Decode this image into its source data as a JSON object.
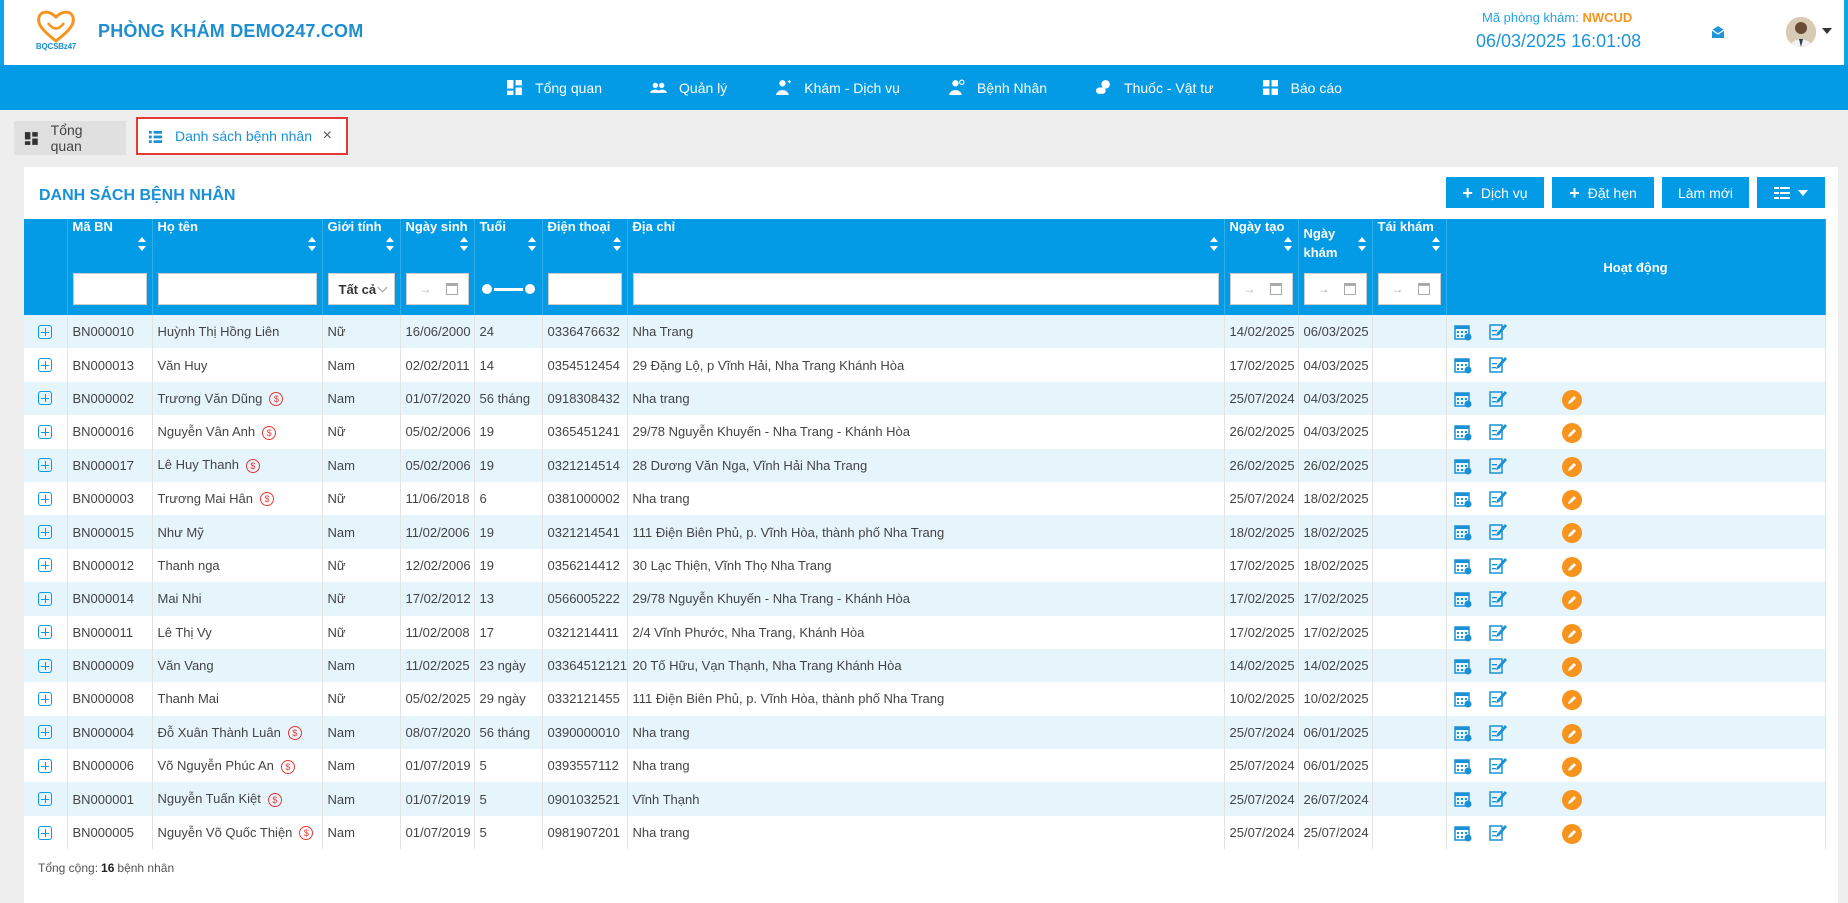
{
  "header": {
    "logo_text": "BQCSBz47",
    "clinic_name": "PHÒNG KHÁM DEMO247.COM",
    "clinic_code_label": "Mã phòng khám:",
    "clinic_code": "NWCUD",
    "datetime": "06/03/2025 16:01:08"
  },
  "nav": [
    {
      "label": "Tổng quan",
      "icon": "dashboard-icon"
    },
    {
      "label": "Quản lý",
      "icon": "users-icon"
    },
    {
      "label": "Khám - Dịch vụ",
      "icon": "doctor-icon"
    },
    {
      "label": "Bệnh Nhân",
      "icon": "patient-icon"
    },
    {
      "label": "Thuốc - Vật tư",
      "icon": "medicine-icon"
    },
    {
      "label": "Báo cáo",
      "icon": "report-icon"
    }
  ],
  "tabs": {
    "overview": "Tổng quan",
    "patients": "Danh sách bệnh nhân",
    "close": "×"
  },
  "panel": {
    "title": "DANH SÁCH BỆNH NHÂN",
    "btn_service": "Dịch vụ",
    "btn_appointment": "Đặt hẹn",
    "btn_refresh": "Làm mới",
    "btn_plus": "+"
  },
  "columns": {
    "code": "Mã BN",
    "name": "Họ tên",
    "gender": "Giới tính",
    "dob": "Ngày sinh",
    "age": "Tuổi",
    "phone": "Điện thoại",
    "address": "Địa chỉ",
    "created": "Ngày tạo",
    "visit": "Ngày khám",
    "revisit": "Tái khám",
    "actions": "Hoạt động"
  },
  "filters": {
    "gender_value": "Tất cả",
    "date_arrow": "→"
  },
  "money_symbol": "$",
  "rows": [
    {
      "code": "BN000010",
      "name": "Huỳnh Thị Hồng Liên",
      "money": false,
      "gender": "Nữ",
      "dob": "16/06/2000",
      "age": "24",
      "phone": "0336476632",
      "address": "Nha Trang",
      "created": "14/02/2025",
      "visit": "06/03/2025",
      "edit": false
    },
    {
      "code": "BN000013",
      "name": "Văn Huy",
      "money": false,
      "gender": "Nam",
      "dob": "02/02/2011",
      "age": "14",
      "phone": "0354512454",
      "address": "29 Đặng Lộ, p Vĩnh Hải, Nha Trang Khánh Hòa",
      "created": "17/02/2025",
      "visit": "04/03/2025",
      "edit": false
    },
    {
      "code": "BN000002",
      "name": "Trương Văn Dũng",
      "money": true,
      "gender": "Nam",
      "dob": "01/07/2020",
      "age": "56 tháng",
      "phone": "0918308432",
      "address": "Nha trang",
      "created": "25/07/2024",
      "visit": "04/03/2025",
      "edit": true
    },
    {
      "code": "BN000016",
      "name": "Nguyễn Vân Anh",
      "money": true,
      "gender": "Nữ",
      "dob": "05/02/2006",
      "age": "19",
      "phone": "0365451241",
      "address": "29/78 Nguyễn Khuyến - Nha Trang - Khánh Hòa",
      "created": "26/02/2025",
      "visit": "04/03/2025",
      "edit": true
    },
    {
      "code": "BN000017",
      "name": "Lê Huy Thanh",
      "money": true,
      "gender": "Nam",
      "dob": "05/02/2006",
      "age": "19",
      "phone": "0321214514",
      "address": "28 Dương Văn Nga, Vĩnh Hải Nha Trang",
      "created": "26/02/2025",
      "visit": "26/02/2025",
      "edit": true
    },
    {
      "code": "BN000003",
      "name": "Trương Mai Hân",
      "money": true,
      "gender": "Nữ",
      "dob": "11/06/2018",
      "age": "6",
      "phone": "0381000002",
      "address": "Nha trang",
      "created": "25/07/2024",
      "visit": "18/02/2025",
      "edit": true
    },
    {
      "code": "BN000015",
      "name": "Như Mỹ",
      "money": false,
      "gender": "Nam",
      "dob": "11/02/2006",
      "age": "19",
      "phone": "0321214541",
      "address": "111 Điện Biên Phủ, p. Vĩnh Hòa, thành phố Nha Trang",
      "created": "18/02/2025",
      "visit": "18/02/2025",
      "edit": true
    },
    {
      "code": "BN000012",
      "name": "Thanh nga",
      "money": false,
      "gender": "Nữ",
      "dob": "12/02/2006",
      "age": "19",
      "phone": "0356214412",
      "address": "30 Lạc Thiện, Vĩnh Thọ Nha Trang",
      "created": "17/02/2025",
      "visit": "18/02/2025",
      "edit": true
    },
    {
      "code": "BN000014",
      "name": "Mai Nhi",
      "money": false,
      "gender": "Nữ",
      "dob": "17/02/2012",
      "age": "13",
      "phone": "0566005222",
      "address": "29/78 Nguyễn Khuyến - Nha Trang - Khánh Hòa",
      "created": "17/02/2025",
      "visit": "17/02/2025",
      "edit": true
    },
    {
      "code": "BN000011",
      "name": "Lê Thị Vy",
      "money": false,
      "gender": "Nữ",
      "dob": "11/02/2008",
      "age": "17",
      "phone": "0321214411",
      "address": "2/4 Vĩnh Phước, Nha Trang, Khánh Hòa",
      "created": "17/02/2025",
      "visit": "17/02/2025",
      "edit": true
    },
    {
      "code": "BN000009",
      "name": "Văn Vang",
      "money": false,
      "gender": "Nam",
      "dob": "11/02/2025",
      "age": "23 ngày",
      "phone": "03364512121",
      "address": "20 Tố Hữu, Vạn Thạnh, Nha Trang Khánh Hòa",
      "created": "14/02/2025",
      "visit": "14/02/2025",
      "edit": true
    },
    {
      "code": "BN000008",
      "name": "Thanh Mai",
      "money": false,
      "gender": "Nữ",
      "dob": "05/02/2025",
      "age": "29 ngày",
      "phone": "0332121455",
      "address": "111 Điện Biên Phủ, p. Vĩnh Hòa, thành phố Nha Trang",
      "created": "10/02/2025",
      "visit": "10/02/2025",
      "edit": true
    },
    {
      "code": "BN000004",
      "name": "Đỗ Xuân Thành Luân",
      "money": true,
      "gender": "Nam",
      "dob": "08/07/2020",
      "age": "56 tháng",
      "phone": "0390000010",
      "address": "Nha trang",
      "created": "25/07/2024",
      "visit": "06/01/2025",
      "edit": true
    },
    {
      "code": "BN000006",
      "name": "Võ Nguyễn Phúc An",
      "money": true,
      "gender": "Nam",
      "dob": "01/07/2019",
      "age": "5",
      "phone": "0393557112",
      "address": "Nha trang",
      "created": "25/07/2024",
      "visit": "06/01/2025",
      "edit": true
    },
    {
      "code": "BN000001",
      "name": "Nguyễn Tuấn Kiệt",
      "money": true,
      "gender": "Nam",
      "dob": "01/07/2019",
      "age": "5",
      "phone": "0901032521",
      "address": "Vĩnh Thạnh",
      "created": "25/07/2024",
      "visit": "26/07/2024",
      "edit": true
    },
    {
      "code": "BN000005",
      "name": "Nguyễn Võ Quốc Thiện",
      "money": true,
      "gender": "Nam",
      "dob": "01/07/2019",
      "age": "5",
      "phone": "0981907201",
      "address": "Nha trang",
      "created": "25/07/2024",
      "visit": "25/07/2024",
      "edit": true
    }
  ],
  "footer": {
    "label": "Tổng cộng:",
    "count": "16",
    "unit": "bệnh nhân"
  },
  "colors": {
    "primary": "#039be5",
    "brand_text": "#1f8ecf",
    "accent_orange": "#f7941d",
    "row_stripe": "#e6f4fb",
    "highlight_border": "#e53935"
  }
}
